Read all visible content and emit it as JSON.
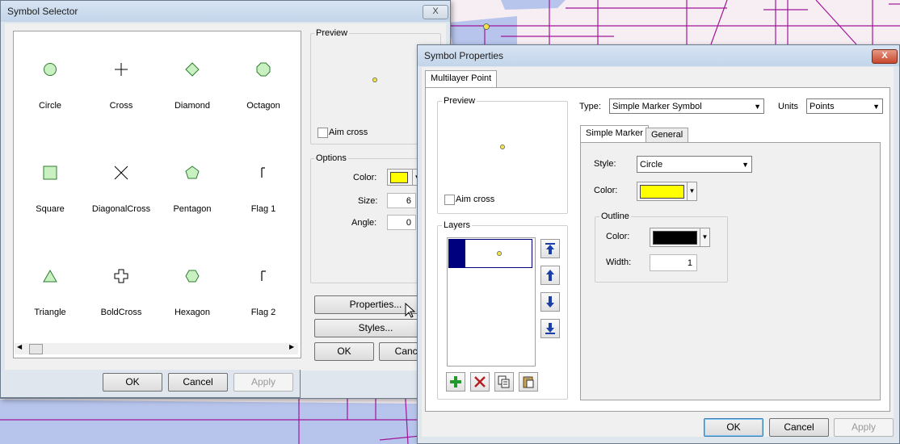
{
  "colors": {
    "map_bg": "#f6eef2",
    "road": "#a0169a",
    "water": "#b7c4ec",
    "marker_fill": "#f0e34a",
    "yellow": "#ffff00",
    "black": "#000000",
    "layer_selected": "#00007f",
    "symbol_fill": "#c8f0c0",
    "symbol_stroke": "#2e7d32"
  },
  "symbol_selector": {
    "title": "Symbol Selector",
    "close_label": "X",
    "symbols": [
      {
        "name": "Circle",
        "icon": "circle-icon"
      },
      {
        "name": "Cross",
        "icon": "cross-icon"
      },
      {
        "name": "Diamond",
        "icon": "diamond-icon"
      },
      {
        "name": "Octagon",
        "icon": "octagon-icon"
      },
      {
        "name": "Square",
        "icon": "square-icon"
      },
      {
        "name": "DiagonalCross",
        "icon": "diagonal-cross-icon"
      },
      {
        "name": "Pentagon",
        "icon": "pentagon-icon"
      },
      {
        "name": "Flag 1",
        "icon": "flag-icon"
      },
      {
        "name": "Triangle",
        "icon": "triangle-icon"
      },
      {
        "name": "BoldCross",
        "icon": "bold-cross-icon"
      },
      {
        "name": "Hexagon",
        "icon": "hexagon-icon"
      },
      {
        "name": "Flag 2",
        "icon": "flag-icon"
      }
    ],
    "preview_label": "Preview",
    "aim_cross_label": "Aim cross",
    "options_label": "Options",
    "color_label": "Color:",
    "size_label": "Size:",
    "size_value": "6",
    "angle_label": "Angle:",
    "angle_value": "0",
    "properties_button": "Properties...",
    "styles_button": "Styles...",
    "ok_inner": "OK",
    "cancel_inner": "Cance",
    "ok": "OK",
    "cancel": "Cancel",
    "apply": "Apply"
  },
  "symbol_properties": {
    "title": "Symbol Properties",
    "close_label": "X",
    "main_tab": "Multilayer Point",
    "preview_label": "Preview",
    "aim_cross_label": "Aim cross",
    "layers_label": "Layers",
    "type_label": "Type:",
    "type_value": "Simple Marker Symbol",
    "units_label": "Units",
    "units_value": "Points",
    "tab_simple_marker": "Simple Marker",
    "tab_general": "General",
    "style_label": "Style:",
    "style_value": "Circle",
    "color_label": "Color:",
    "outline_label": "Outline",
    "outline_color_label": "Color:",
    "width_label": "Width:",
    "width_value": "1",
    "ok": "OK",
    "cancel": "Cancel",
    "apply": "Apply"
  }
}
